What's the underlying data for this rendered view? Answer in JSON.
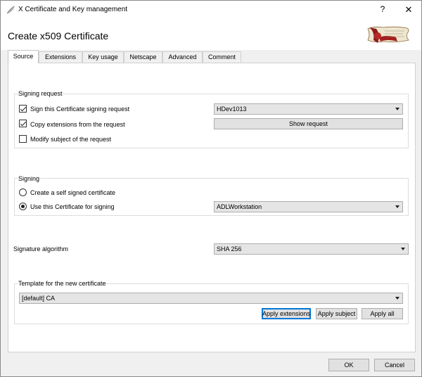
{
  "window": {
    "title": "X Certificate and Key management",
    "help_label": "?",
    "close_label": "✕"
  },
  "dialog_title": "Create x509 Certificate",
  "tabs": [
    {
      "label": "Source"
    },
    {
      "label": "Extensions"
    },
    {
      "label": "Key usage"
    },
    {
      "label": "Netscape"
    },
    {
      "label": "Advanced"
    },
    {
      "label": "Comment"
    }
  ],
  "signing_request": {
    "group_label": "Signing request",
    "sign_csr": {
      "label": "Sign this Certificate signing request",
      "checked": true
    },
    "csr_select": "HDev1013",
    "copy_extensions": {
      "label": "Copy extensions from the request",
      "checked": true
    },
    "show_request_label": "Show request",
    "modify_subject": {
      "label": "Modify subject of the request",
      "checked": false
    }
  },
  "signing": {
    "group_label": "Signing",
    "self_signed_label": "Create a self signed certificate",
    "use_cert_label": "Use this Certificate for signing",
    "signing_cert_select": "ADLWorkstation"
  },
  "signature_algorithm": {
    "label": "Signature algorithm",
    "value": "SHA 256"
  },
  "template": {
    "group_label": "Template for the new certificate",
    "value": "[default] CA",
    "apply_extensions_label": "Apply extensions",
    "apply_subject_label": "Apply subject",
    "apply_all_label": "Apply all"
  },
  "footer": {
    "ok_label": "OK",
    "cancel_label": "Cancel"
  }
}
